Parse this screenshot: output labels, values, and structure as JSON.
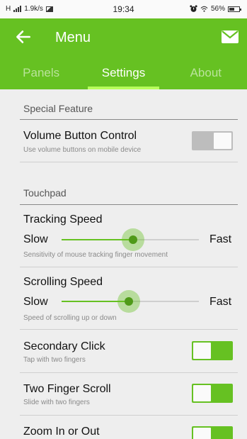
{
  "status_bar": {
    "carrier": "H",
    "speed": "1.9k/s",
    "time": "19:34",
    "battery": "56%"
  },
  "app_bar": {
    "title": "Menu",
    "tabs": [
      {
        "label": "Panels",
        "active": false
      },
      {
        "label": "Settings",
        "active": true
      },
      {
        "label": "About",
        "active": false
      }
    ]
  },
  "sections": {
    "special_feature": "Special Feature",
    "touchpad": "Touchpad"
  },
  "volume_button": {
    "title": "Volume Button Control",
    "desc": "Use volume buttons on mobile device",
    "enabled": false
  },
  "tracking_speed": {
    "title": "Tracking Speed",
    "min_label": "Slow",
    "max_label": "Fast",
    "desc": "Sensitivity of mouse tracking finger movement",
    "value": 0.52
  },
  "scrolling_speed": {
    "title": "Scrolling Speed",
    "min_label": "Slow",
    "max_label": "Fast",
    "desc": "Speed of scrolling up or down",
    "value": 0.49
  },
  "secondary_click": {
    "title": "Secondary Click",
    "desc": "Tap with two fingers",
    "enabled": true
  },
  "two_finger_scroll": {
    "title": "Two Finger Scroll",
    "desc": "Slide with two fingers",
    "enabled": true
  },
  "zoom": {
    "title": "Zoom In or Out",
    "enabled": true
  },
  "colors": {
    "accent": "#66c122",
    "accent_light": "#b8ff5c",
    "background": "#eeeeee"
  }
}
